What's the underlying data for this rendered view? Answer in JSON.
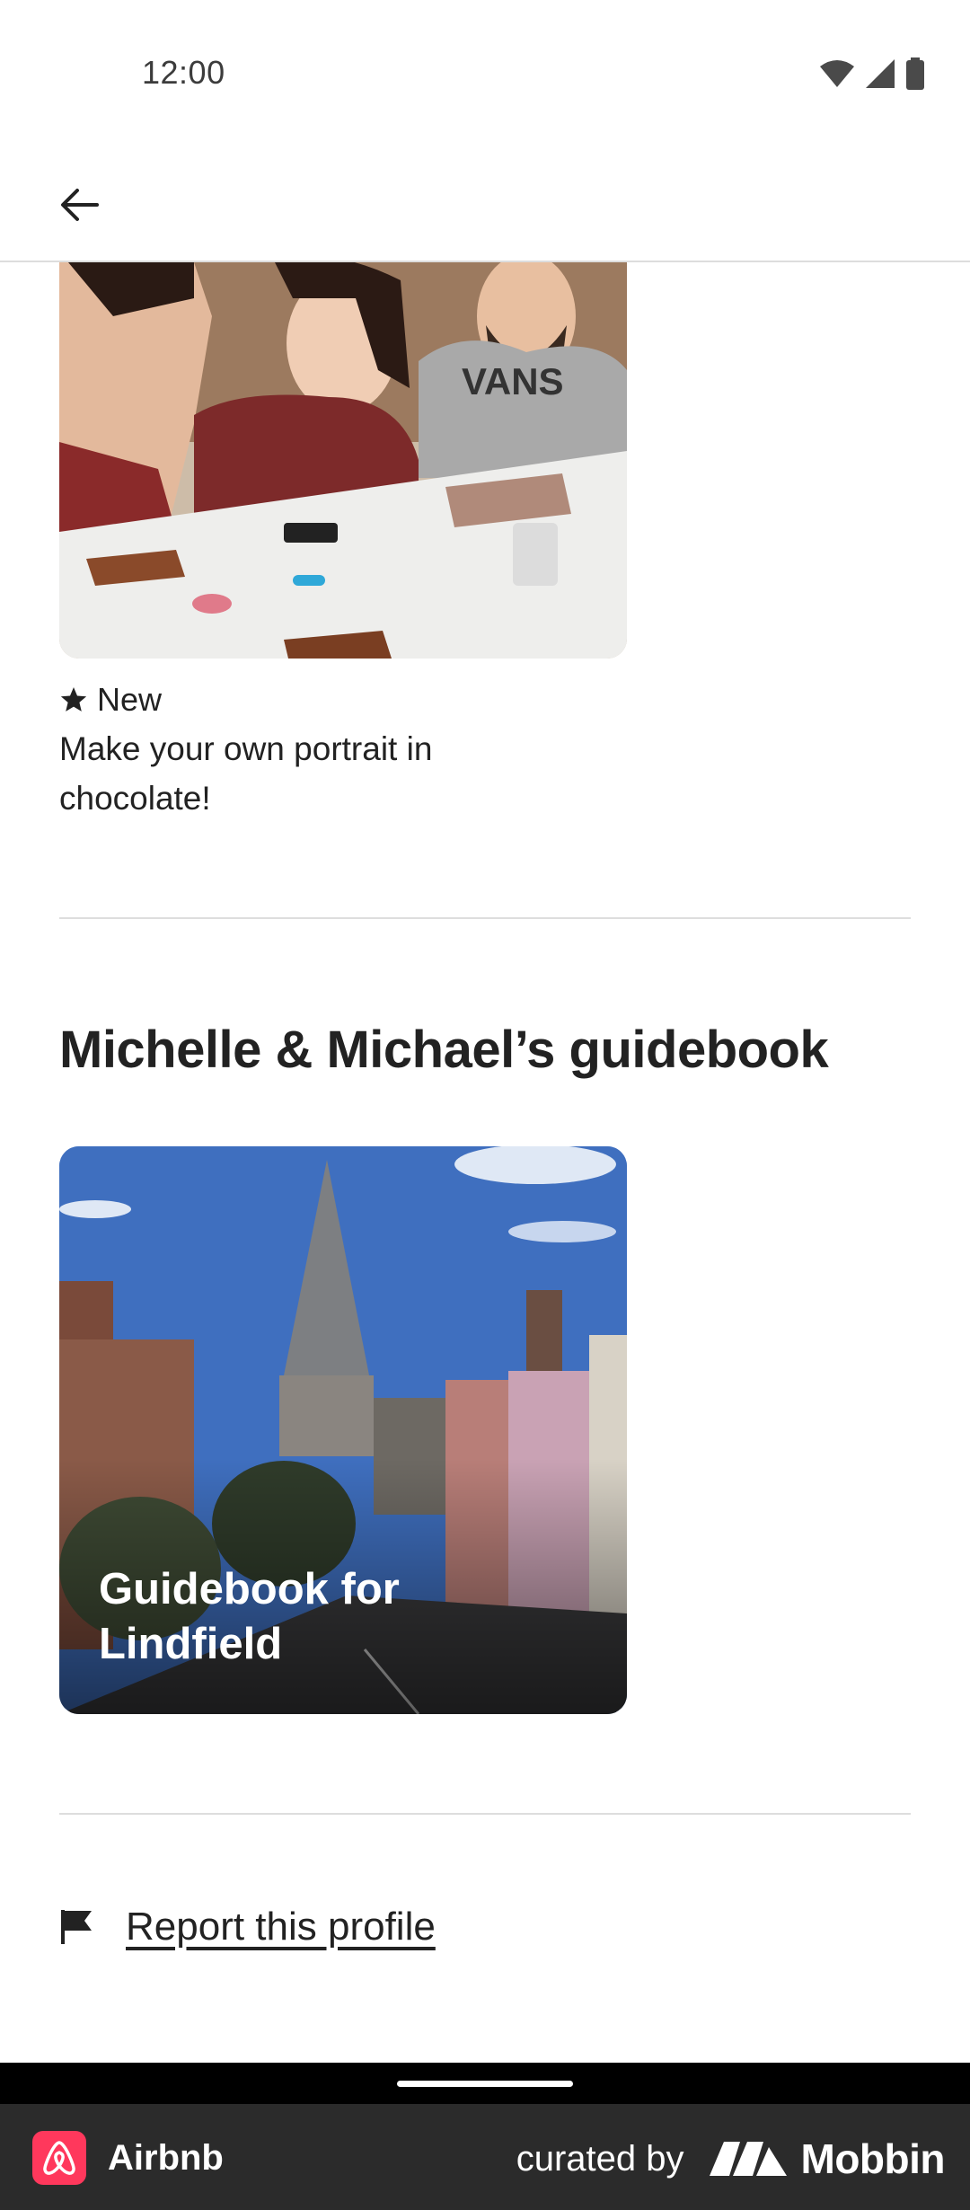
{
  "status_bar": {
    "time": "12:00"
  },
  "experience": {
    "rating_label": "New",
    "title": "Make your own portrait in chocolate!",
    "shirt_print": "VANS"
  },
  "guidebook": {
    "heading": "Michelle & Michael’s guidebook",
    "card_title": "Guidebook for Lindfield"
  },
  "report": {
    "label": "Report this profile"
  },
  "footer": {
    "app_name": "Airbnb",
    "curated_by": "curated by",
    "brand": "Mobbin"
  },
  "colors": {
    "brand_accent": "#ff385c",
    "text_primary": "#222222",
    "divider": "#dddddd",
    "footer_bg": "#2b2b2b"
  }
}
